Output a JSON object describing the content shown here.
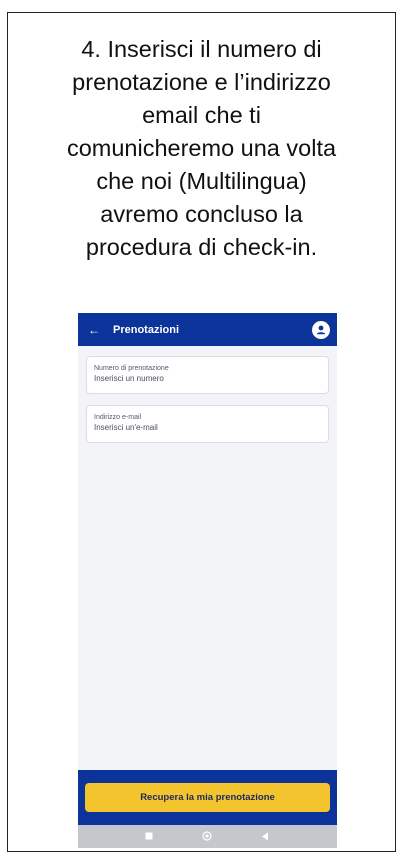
{
  "instruction": {
    "lines": [
      "4. Inserisci il numero di",
      "prenotazione e l’indirizzo",
      "email che ti",
      "comunicheremo una volta",
      "che noi (Multilingua)",
      "avremo concluso la",
      "procedura di check-in."
    ]
  },
  "app": {
    "title": "Prenotazioni",
    "back_icon": "back-arrow-icon",
    "avatar_icon": "user-avatar-icon",
    "fields": [
      {
        "label": "Numero di prenotazione",
        "placeholder": "Inserisci un numero"
      },
      {
        "label": "Indirizzo e-mail",
        "placeholder": "Inserisci un'e-mail"
      }
    ],
    "cta_label": "Recupera la mia prenotazione",
    "navbar_icons": [
      "recent-apps-icon",
      "home-icon",
      "back-icon"
    ]
  },
  "colors": {
    "brand": "#0c3399",
    "accent": "#f4c42f",
    "screen_bg": "#f3f4f8"
  }
}
